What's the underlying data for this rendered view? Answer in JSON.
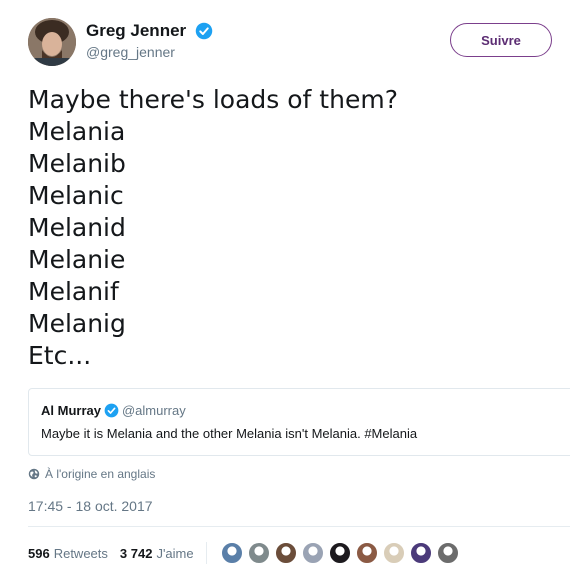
{
  "author": {
    "name": "Greg Jenner",
    "handle": "@greg_jenner"
  },
  "follow_label": "Suivre",
  "tweet_lines": [
    "Maybe there's loads of them?",
    "Melania",
    "Melanib",
    "Melanic",
    "Melanid",
    "Melanie",
    "Melanif",
    "Melanig",
    "Etc..."
  ],
  "quote": {
    "name": "Al Murray",
    "handle": "@almurray",
    "text": "Maybe it is Melania and the other Melania isn't Melania. #Melania"
  },
  "translate_label": "À l'origine en anglais",
  "timestamp": "17:45 - 18 oct. 2017",
  "stats": {
    "retweets_count": "596",
    "retweets_label": "Retweets",
    "likes_count": "3 742",
    "likes_label": "J'aime"
  },
  "colors": {
    "verified": "#1da1f2",
    "follow_border": "#7b3f8c",
    "secondary_text": "#657786"
  },
  "icons": [
    "verified-badge-icon",
    "globe-icon"
  ],
  "liker_avatar_colors": [
    "#5a7fa8",
    "#7f8a8c",
    "#6b4d3a",
    "#9aa3b4",
    "#1d1a1e",
    "#8b5a44",
    "#d9cdb8",
    "#4b3a7a",
    "#6c6c6c"
  ]
}
